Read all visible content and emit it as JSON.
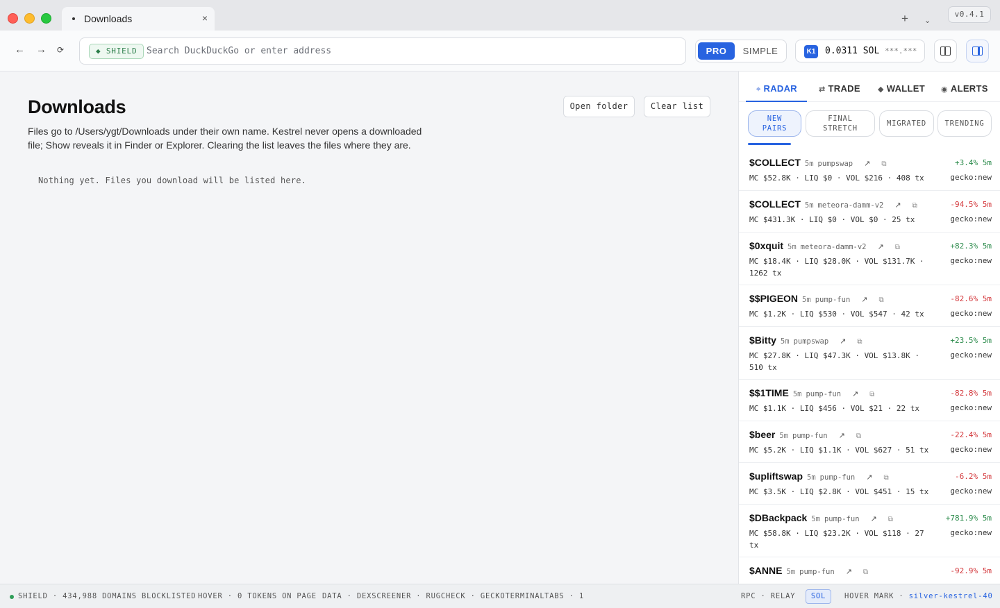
{
  "window": {
    "tab_title": "Downloads",
    "tab_close": "×",
    "new_tab": "+",
    "tab_menu": "⌄",
    "version": "v0.4.1"
  },
  "toolbar": {
    "back": "←",
    "forward": "→",
    "reload": "⟳",
    "shield_label": "◆ SHIELD",
    "address_placeholder": "Search DuckDuckGo or enter address",
    "address_value": "",
    "mode_pro": "PRO",
    "mode_simple": "SIMPLE",
    "wallet_badge": "K1",
    "wallet_balance": "0.0311 SOL",
    "wallet_mask": "***.***"
  },
  "main": {
    "title": "Downloads",
    "open_folder": "Open folder",
    "clear_list": "Clear list",
    "description": "Files go to /Users/ygt/Downloads under their own name. Kestrel never opens a downloaded file; Show reveals it in Finder or Explorer. Clearing the list leaves the files where they are.",
    "empty_message": "Nothing yet. Files you download will be listed here."
  },
  "sidebar": {
    "tabs": [
      {
        "icon": "⌖",
        "label": "RADAR"
      },
      {
        "icon": "⇄",
        "label": "TRADE"
      },
      {
        "icon": "◆",
        "label": "WALLET"
      },
      {
        "icon": "◉",
        "label": "ALERTS"
      }
    ],
    "filters": [
      {
        "line1": "NEW",
        "line2": "PAIRS"
      },
      {
        "line1": "FINAL",
        "line2": "STRETCH"
      },
      {
        "line1": "MIGRATED",
        "line2": ""
      },
      {
        "line1": "TRENDING",
        "line2": ""
      }
    ],
    "external_icon": "↗",
    "copy_icon": "⧉",
    "tokens": [
      {
        "name": "$COLLECT",
        "age": "5m",
        "dex": "pumpswap",
        "change": "+3.4% 5m",
        "dir": "up",
        "stats": "MC $52.8K · LIQ $0 · VOL $216 · 408 tx",
        "source": "gecko:new"
      },
      {
        "name": "$COLLECT",
        "age": "5m",
        "dex": "meteora-damm-v2",
        "change": "-94.5% 5m",
        "dir": "down",
        "stats": "MC $431.3K · LIQ $0 · VOL $0 · 25 tx",
        "source": "gecko:new"
      },
      {
        "name": "$0xquit",
        "age": "5m",
        "dex": "meteora-damm-v2",
        "change": "+82.3% 5m",
        "dir": "up",
        "stats": "MC $18.4K · LIQ $28.0K · VOL $131.7K · 1262 tx",
        "source": "gecko:new"
      },
      {
        "name": "$$PIGEON",
        "age": "5m",
        "dex": "pump-fun",
        "change": "-82.6% 5m",
        "dir": "down",
        "stats": "MC $1.2K · LIQ $530 · VOL $547 · 42 tx",
        "source": "gecko:new"
      },
      {
        "name": "$Bitty",
        "age": "5m",
        "dex": "pumpswap",
        "change": "+23.5% 5m",
        "dir": "up",
        "stats": "MC $27.8K · LIQ $47.3K · VOL $13.8K · 510 tx",
        "source": "gecko:new"
      },
      {
        "name": "$$1TIME",
        "age": "5m",
        "dex": "pump-fun",
        "change": "-82.8% 5m",
        "dir": "down",
        "stats": "MC $1.1K · LIQ $456 · VOL $21 · 22 tx",
        "source": "gecko:new"
      },
      {
        "name": "$beer",
        "age": "5m",
        "dex": "pump-fun",
        "change": "-22.4% 5m",
        "dir": "down",
        "stats": "MC $5.2K · LIQ $1.1K · VOL $627 · 51 tx",
        "source": "gecko:new"
      },
      {
        "name": "$upliftswap",
        "age": "5m",
        "dex": "pump-fun",
        "change": "-6.2% 5m",
        "dir": "down",
        "stats": "MC $3.5K · LIQ $2.8K · VOL $451 · 15 tx",
        "source": "gecko:new"
      },
      {
        "name": "$DBackpack",
        "age": "5m",
        "dex": "pump-fun",
        "change": "+781.9% 5m",
        "dir": "up",
        "stats": "MC $58.8K · LIQ $23.2K · VOL $118 · 27 tx",
        "source": "gecko:new"
      },
      {
        "name": "$ANNE",
        "age": "5m",
        "dex": "pump-fun",
        "change": "-92.9% 5m",
        "dir": "down",
        "stats": "",
        "source": ""
      }
    ]
  },
  "statusbar": {
    "shield": "SHIELD · 434,988 DOMAINS BLOCKLISTED",
    "hover": "HOVER · 0 TOKENS ON PAGE",
    "data": "DATA · DEXSCREENER · RUGCHECK · GECKOTERMINAL",
    "tabs": "TABS · 1",
    "rpc": "RPC · RELAY",
    "sol": "SOL",
    "hover_mark_label": "HOVER MARK ·",
    "hover_mark_value": "silver-kestrel-40"
  }
}
